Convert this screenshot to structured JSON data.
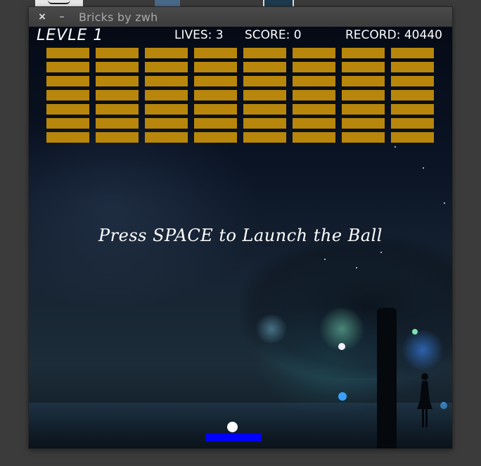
{
  "window": {
    "title": "Bricks by zwh",
    "close_label": "×",
    "minimize_label": "–"
  },
  "hud": {
    "level": "LEVLE 1",
    "lives": "LIVES: 3",
    "score": "SCORE: 0",
    "record": "RECORD: 40440"
  },
  "message": "Press SPACE to Launch the Ball",
  "bricks": {
    "rows": 7,
    "columns": 8,
    "color": "#b8860b"
  },
  "paddle_color": "#0000ff",
  "ball_color": "#ffffff"
}
